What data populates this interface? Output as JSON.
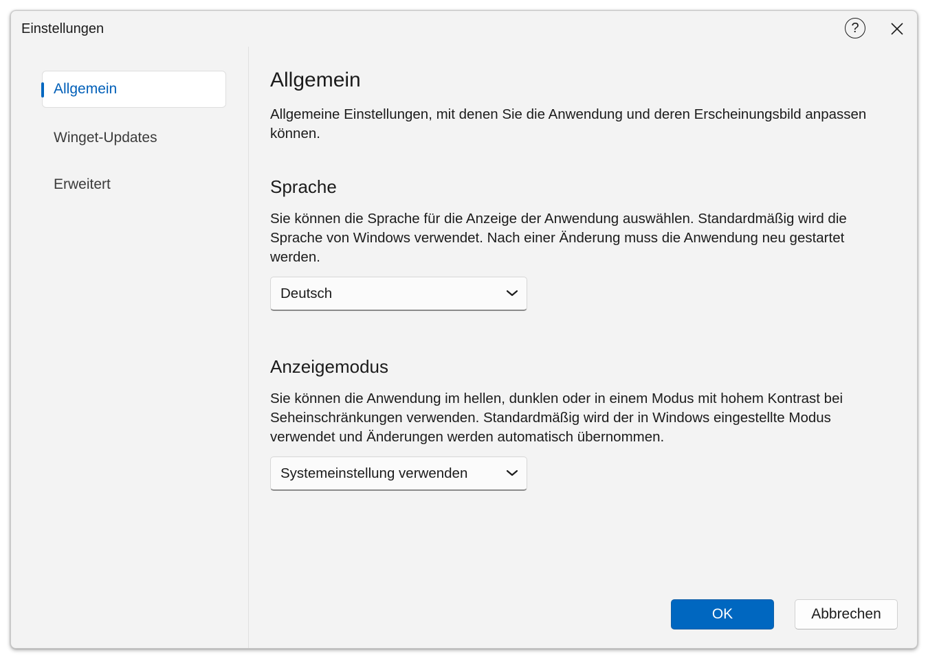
{
  "window": {
    "title": "Einstellungen",
    "help_icon": "help-circle-icon",
    "close_icon": "close-icon"
  },
  "sidebar": {
    "items": [
      {
        "label": "Allgemein",
        "active": true
      },
      {
        "label": "Winget-Updates",
        "active": false
      },
      {
        "label": "Erweitert",
        "active": false
      }
    ]
  },
  "main": {
    "title": "Allgemein",
    "description": "Allgemeine Einstellungen, mit denen Sie die Anwendung und deren Erscheinungsbild anpassen können.",
    "language": {
      "heading": "Sprache",
      "description": "Sie können die Sprache für die Anzeige der Anwendung auswählen. Standardmäßig wird die Sprache von Windows verwendet. Nach einer Änderung muss die Anwendung neu gestartet werden.",
      "selected": "Deutsch"
    },
    "display_mode": {
      "heading": "Anzeigemodus",
      "description": "Sie können die Anwendung im hellen, dunklen oder in einem Modus mit hohem Kontrast bei Seheinschränkungen verwenden. Standardmäßig wird der in Windows eingestellte Modus verwendet und Änderungen werden automatisch übernommen.",
      "selected": "Systemeinstellung verwenden"
    }
  },
  "footer": {
    "ok_label": "OK",
    "cancel_label": "Abbrechen"
  },
  "colors": {
    "accent": "#0067c0",
    "window_bg": "#f3f3f3"
  }
}
